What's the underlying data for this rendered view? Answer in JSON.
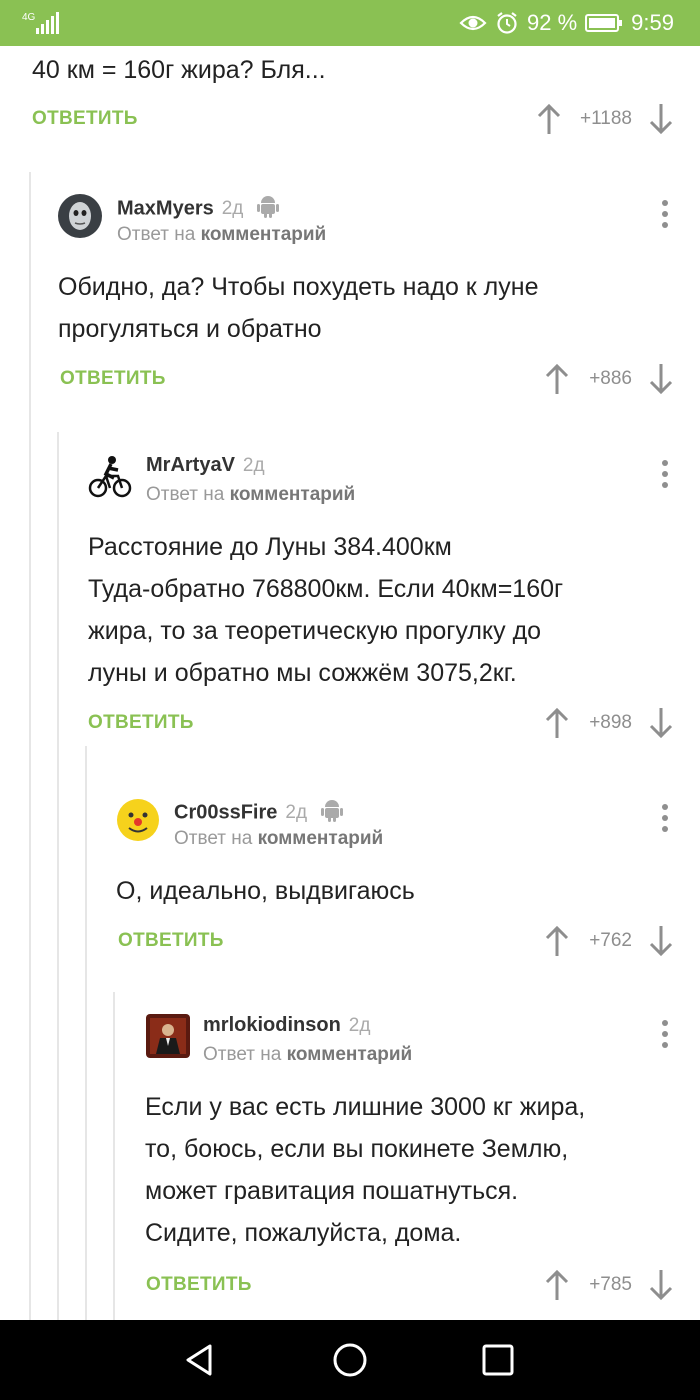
{
  "status_bar": {
    "network": "4G",
    "battery_percent": "92 %",
    "time": "9:59",
    "icons": [
      "signal-icon",
      "eye-icon",
      "alarm-icon",
      "battery-icon"
    ]
  },
  "colors": {
    "accent": "#8ac153",
    "navbar": "#000000"
  },
  "top_comment": {
    "text": "40 км = 160г жира? Бля...",
    "reply_label": "ОТВЕТИТЬ",
    "score": "+1188"
  },
  "comments": [
    {
      "username": "MaxMyers",
      "time_ago": "2д",
      "android": true,
      "reply_prefix": "Ответ на",
      "reply_target": "комментарий",
      "lines": [
        "Обидно, да? Чтобы похудеть надо к луне",
        "прогуляться и обратно"
      ],
      "reply_label": "ОТВЕТИТЬ",
      "score": "+886"
    },
    {
      "username": "MrArtyaV",
      "time_ago": "2д",
      "android": false,
      "reply_prefix": "Ответ на",
      "reply_target": "комментарий",
      "lines": [
        "Расстояние до Луны 384.400км",
        "Туда-обратно 768800км. Если 40км=160г",
        "жира, то за теоретическую прогулку до",
        "луны и обратно мы сожжём 3075,2кг."
      ],
      "reply_label": "ОТВЕТИТЬ",
      "score": "+898"
    },
    {
      "username": "Cr00ssFire",
      "time_ago": "2д",
      "android": true,
      "reply_prefix": "Ответ на",
      "reply_target": "комментарий",
      "lines": [
        "О, идеально, выдвигаюсь"
      ],
      "reply_label": "ОТВЕТИТЬ",
      "score": "+762"
    },
    {
      "username": "mrlokiodinson",
      "time_ago": "2д",
      "android": false,
      "reply_prefix": "Ответ на",
      "reply_target": "комментарий",
      "lines": [
        "Если у вас есть лишние 3000 кг жира,",
        "то, боюсь, если вы покинете Землю,",
        "может гравитация пошатнуться.",
        "Сидите, пожалуйста, дома."
      ],
      "reply_label": "ОТВЕТИТЬ",
      "score": "+785"
    }
  ],
  "nav_bar": {
    "buttons": [
      "back-icon",
      "home-icon",
      "recents-icon"
    ]
  }
}
